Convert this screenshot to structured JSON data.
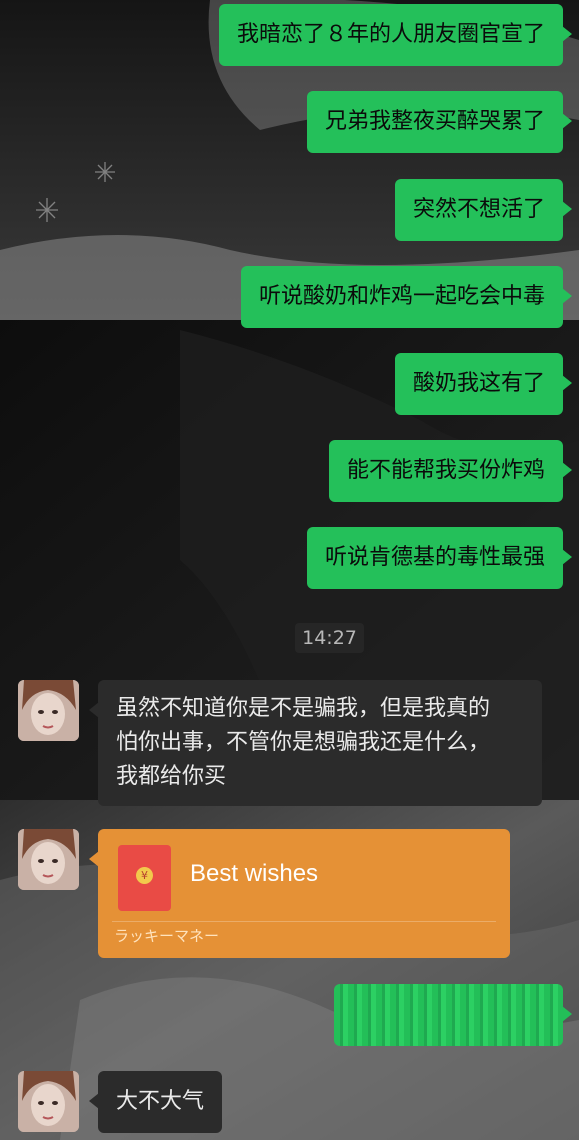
{
  "theme": {
    "outgoing_bubble_color": "#24c05a",
    "incoming_bubble_color": "#2b2b2b",
    "red_packet_color": "#e59136"
  },
  "messages_sent_top": [
    "我暗恋了８年的人朋友圈官宣了",
    "兄弟我整夜买醉哭累了",
    "突然不想活了",
    "听说酸奶和炸鸡一起吃会中毒",
    "酸奶我这有了",
    "能不能帮我买份炸鸡",
    "听说肯德基的毒性最强"
  ],
  "timestamp": "14:27",
  "incoming_message_1": {
    "line1": "虽然不知道你是不是骗我，但是我真的",
    "line2": "怕你出事，不管你是想骗我还是什么，",
    "line3": "我都给你买"
  },
  "red_packet": {
    "icon": "red-envelope-icon",
    "coin_symbol": "¥",
    "title": "Best wishes",
    "subtitle": "ラッキーマネー"
  },
  "incoming_message_2": "大不大气"
}
